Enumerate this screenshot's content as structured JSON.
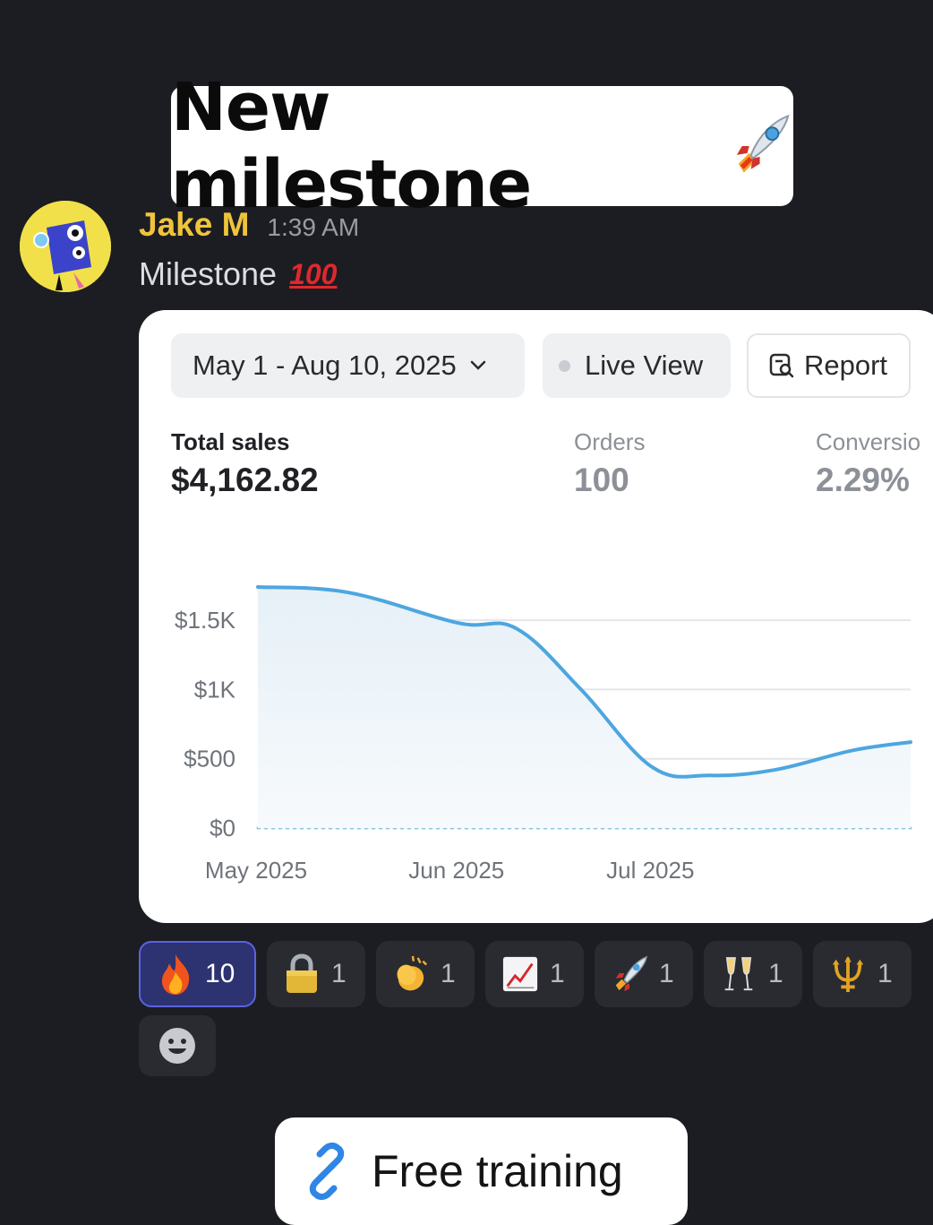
{
  "banner": {
    "title": "New milestone",
    "icon": "rocket-emoji"
  },
  "post": {
    "author": "Jake M",
    "time": "1:39 AM",
    "text": "Milestone",
    "text_emoji": "100",
    "avatar_icon": "blue-monster-avatar",
    "author_color": "#f0c43a"
  },
  "dashboard": {
    "date_range": "May 1 - Aug 10, 2025",
    "live_view": "Live View",
    "report": "Report",
    "metrics": [
      {
        "label": "Total sales",
        "value": "$4,162.82"
      },
      {
        "label": "Orders",
        "value": "100"
      },
      {
        "label": "Conversio",
        "value": "2.29%"
      }
    ]
  },
  "chart_data": {
    "type": "area",
    "x": [
      "2025-05-01",
      "2025-05-15",
      "2025-06-01",
      "2025-06-10",
      "2025-06-20",
      "2025-07-01",
      "2025-07-10",
      "2025-07-20",
      "2025-08-01",
      "2025-08-10"
    ],
    "values": [
      1740,
      1700,
      1480,
      1440,
      1000,
      440,
      380,
      420,
      560,
      620
    ],
    "ylim": [
      0,
      1740
    ],
    "y_ticks": [
      "$1.5K",
      "$1K",
      "$500",
      "$0"
    ],
    "y_tick_values": [
      1500,
      1000,
      500,
      0
    ],
    "x_ticks": [
      "May 2025",
      "Jun 2025",
      "Jul 2025"
    ],
    "x_tick_values": [
      "2025-05-01",
      "2025-06-01",
      "2025-07-01"
    ],
    "line_color": "#4da6e0",
    "grid": true
  },
  "reactions": [
    {
      "icon": "fire-emoji",
      "count": "10",
      "active": true
    },
    {
      "icon": "lock-emoji",
      "count": "1"
    },
    {
      "icon": "clapping-hands-emoji",
      "count": "1"
    },
    {
      "icon": "chart-increasing-emoji",
      "count": "1"
    },
    {
      "icon": "rocket-emoji",
      "count": "1"
    },
    {
      "icon": "champagne-glasses-emoji",
      "count": "1"
    },
    {
      "icon": "trident-emoji",
      "count": "1"
    }
  ],
  "cta": {
    "label": "Free training",
    "icon": "link-icon"
  }
}
